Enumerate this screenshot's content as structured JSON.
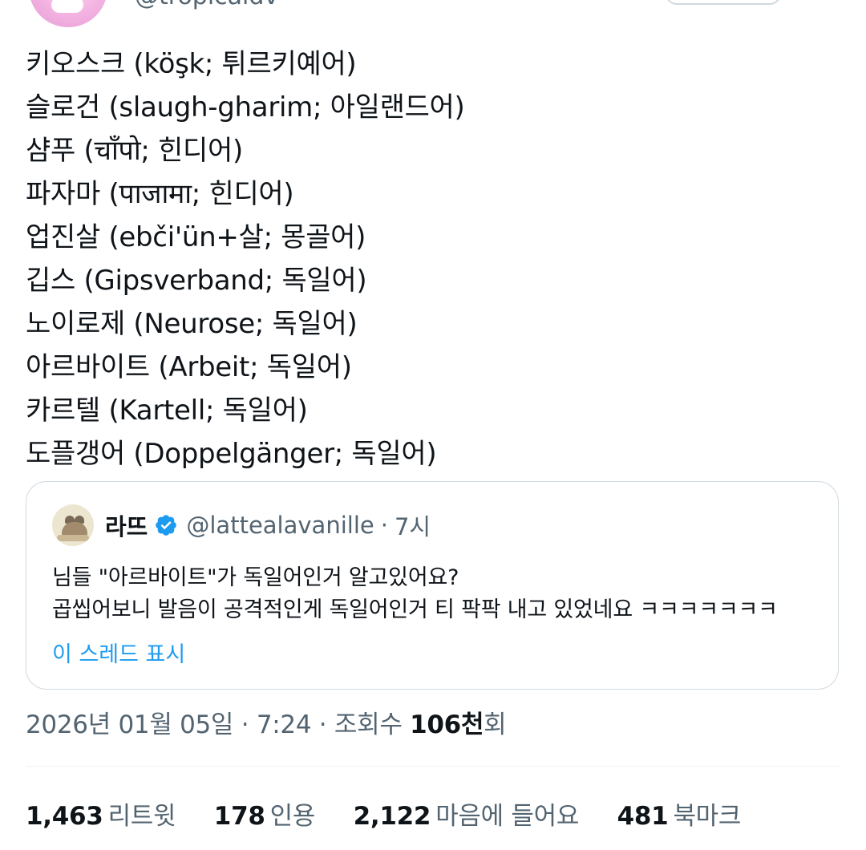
{
  "author": {
    "handle": "@tropicaldv"
  },
  "tweet": {
    "lines": [
      "키오스크 (köşk; 튀르키예어)",
      "슬로건 (slaugh-gharim; 아일랜드어)",
      "샴푸 (चाँपो; 힌디어)",
      "파자마 (पाजामा; 힌디어)",
      "업진살 (ebči'ün+살; 몽골어)",
      "깁스 (Gipsverband; 독일어)",
      "노이로제 (Neurose; 독일어)",
      "아르바이트 (Arbeit; 독일어)",
      "카르텔 (Kartell; 독일어)",
      "도플갱어 (Doppelgänger; 독일어)"
    ]
  },
  "quote": {
    "name": "라뜨",
    "handle": "@lattealavanille",
    "dot": "·",
    "time": "7시",
    "lines": [
      "님들 \"아르바이트\"가 독일어인거 알고있어요?",
      "곱씹어보니 발음이 공격적인게 독일어인거 티 팍팍 내고 있었네요 ㅋㅋㅋㅋㅋㅋㅋ"
    ],
    "show_thread": "이 스레드 표시",
    "verified_color": "#1d9bf0"
  },
  "meta": {
    "date": "2026년 01월 05일",
    "sep1": " · ",
    "time": "7:24",
    "sep2": " · ",
    "views_label": "조회수 ",
    "views_count": "106천",
    "views_suffix": "회"
  },
  "stats": {
    "retweets": {
      "count": "1,463",
      "label": "리트윗"
    },
    "quotes": {
      "count": "178",
      "label": "인용"
    },
    "likes": {
      "count": "2,122",
      "label": "마음에 들어요"
    },
    "bookmarks": {
      "count": "481",
      "label": "북마크"
    }
  },
  "colors": {
    "text": "#0f1419",
    "secondary": "#536471",
    "link": "#1d9bf0",
    "border": "#cfd9de"
  }
}
